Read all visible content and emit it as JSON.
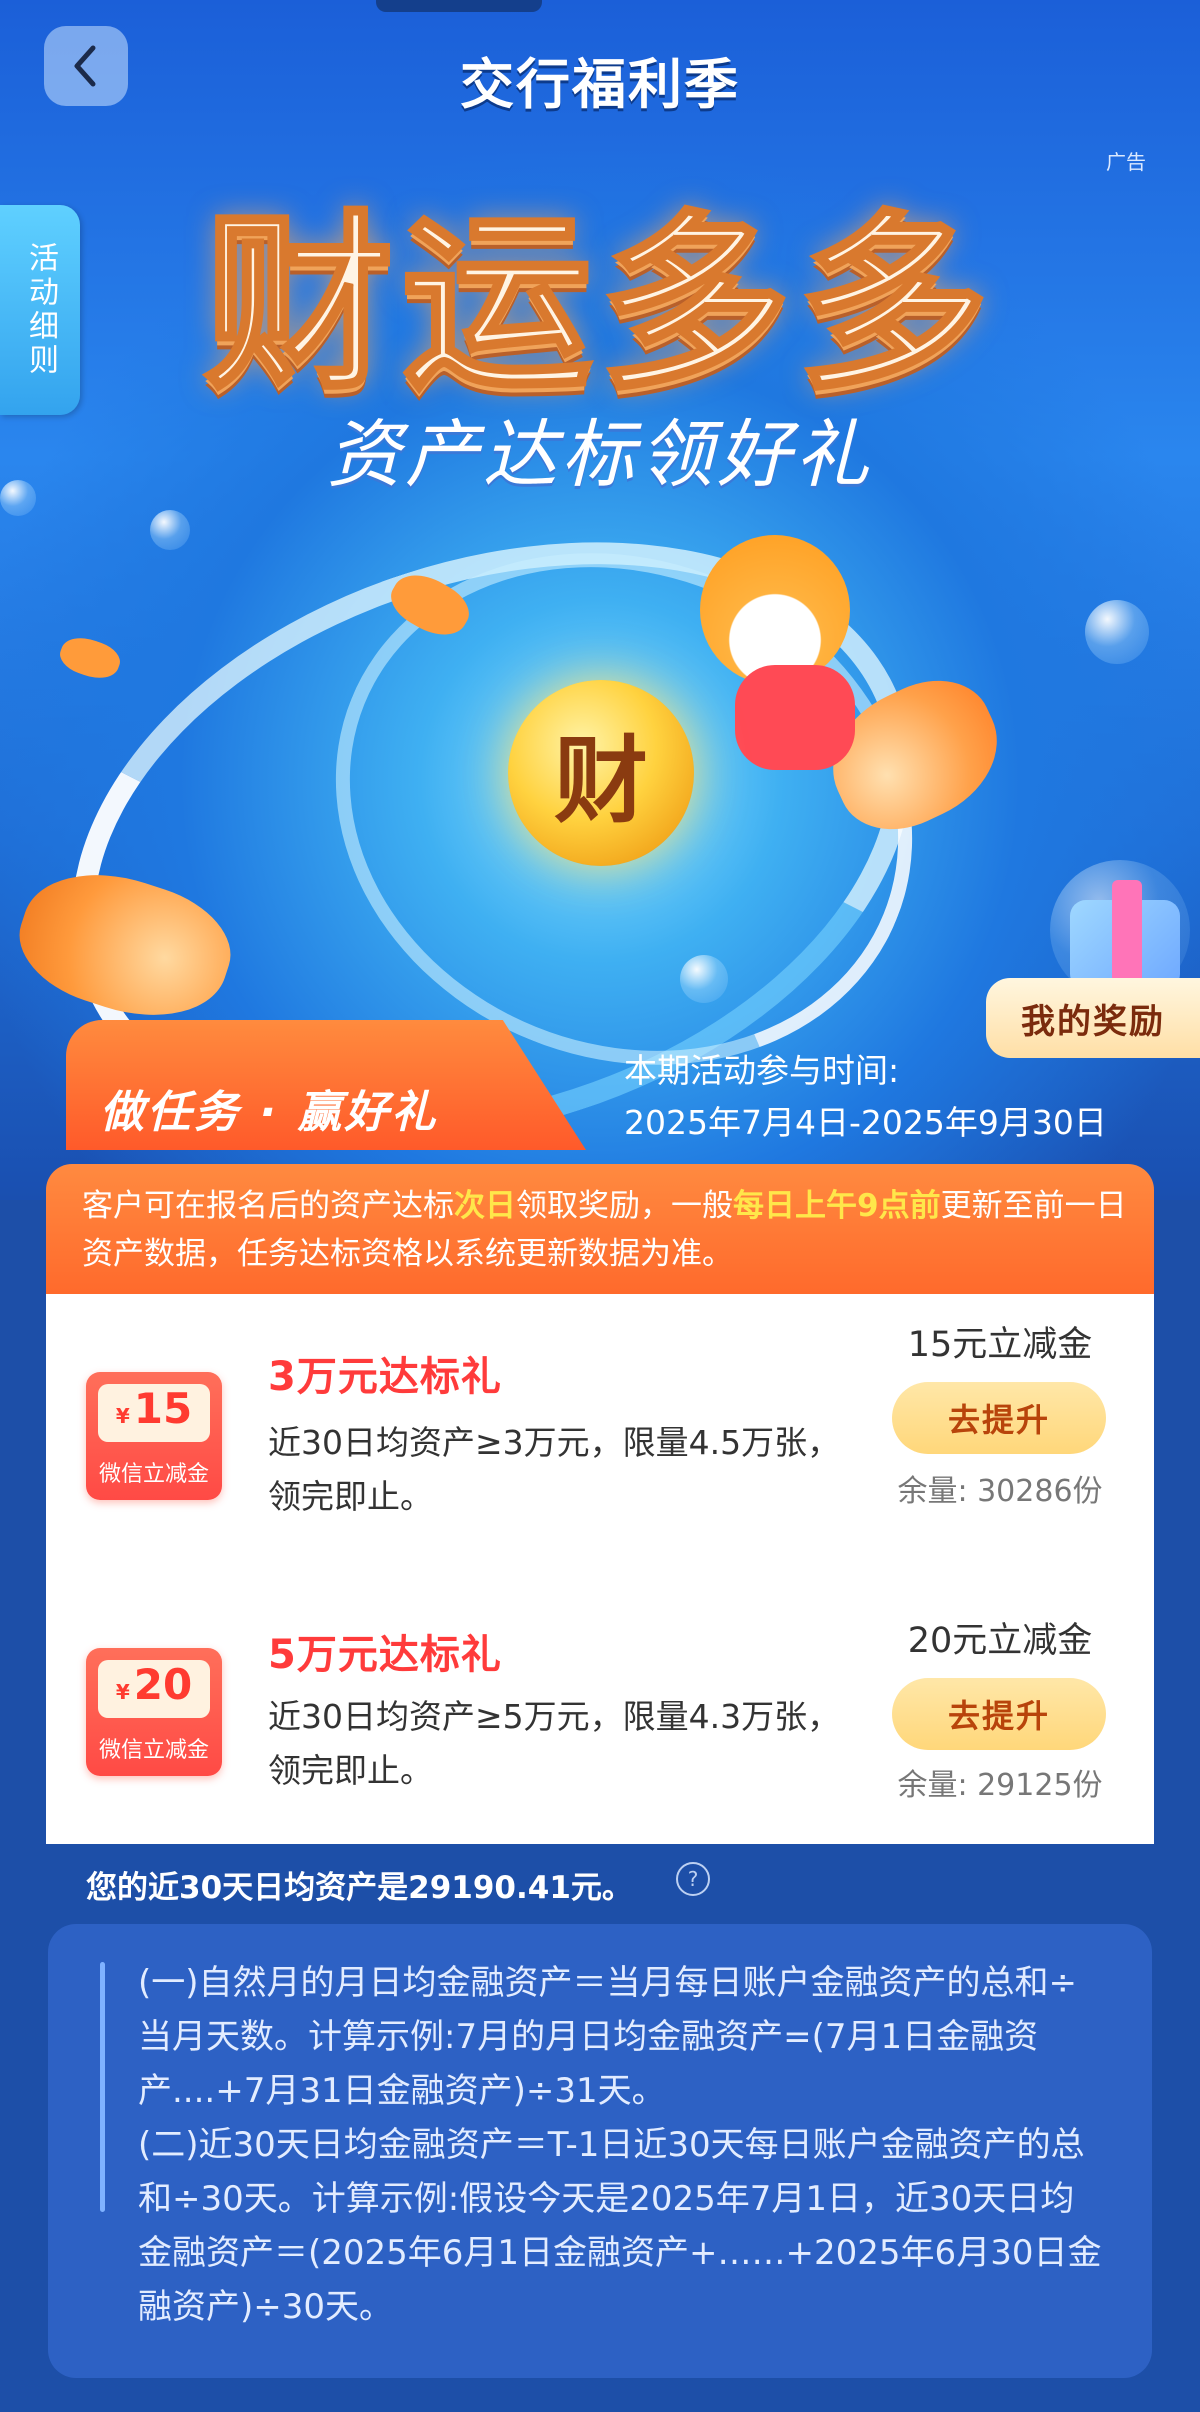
{
  "header": {
    "brand": "交行福利季",
    "ad_tag": "广告",
    "side_rules": "活动细则"
  },
  "hero": {
    "headline": "财运多多",
    "subline": "资产达标领好礼",
    "coin_text": "财",
    "my_reward": "我的奖励"
  },
  "task": {
    "tab_label": "做任务 · 赢好礼",
    "period_label": "本期活动参与时间:",
    "period_value": "2025年7月4日-2025年9月30日"
  },
  "notice": {
    "part1": "客户可在报名后的资产达标",
    "hl1": "次日",
    "part2": "领取奖励，一般",
    "hl2": "每日上午9点前",
    "part3": "更新至前一日资产数据，任务达标资格以系统更新数据为准。"
  },
  "rewards": [
    {
      "ticket_currency": "¥",
      "ticket_amount": "15",
      "ticket_label": "微信立减金",
      "title": "3万元达标礼",
      "desc": "近30日均资产≥3万元，限量4.5万张，领完即止。",
      "amount_label": "15元立减金",
      "button": "去提升",
      "remain": "余量: 30286份"
    },
    {
      "ticket_currency": "¥",
      "ticket_amount": "20",
      "ticket_label": "微信立减金",
      "title": "5万元达标礼",
      "desc": "近30日均资产≥5万元，限量4.3万张，领完即止。",
      "amount_label": "20元立减金",
      "button": "去提升",
      "remain": "余量: 29125份"
    }
  ],
  "assets": {
    "avg_text": "您的近30天日均资产是29190.41元。",
    "help_icon": "?"
  },
  "explain": {
    "text1": "(一)自然月的月日均金融资产＝当月每日账户金融资产的总和÷当月天数。计算示例:7月的月日均金融资产=(7月1日金融资产....+7月31日金融资产)÷31天。",
    "text2": "(二)近30天日均金融资产＝T-1日近30天每日账户金融资产的总和÷30天。计算示例:假设今天是2025年7月1日，近30天日均金融资产＝(2025年6月1日金融资产+……+2025年6月30日金融资产)÷30天。"
  },
  "colors": {
    "brand_blue": "#1d4fa8",
    "orange": "#ff6a2c",
    "highlight": "#ffe74a",
    "title_red": "#ff3b3b"
  }
}
